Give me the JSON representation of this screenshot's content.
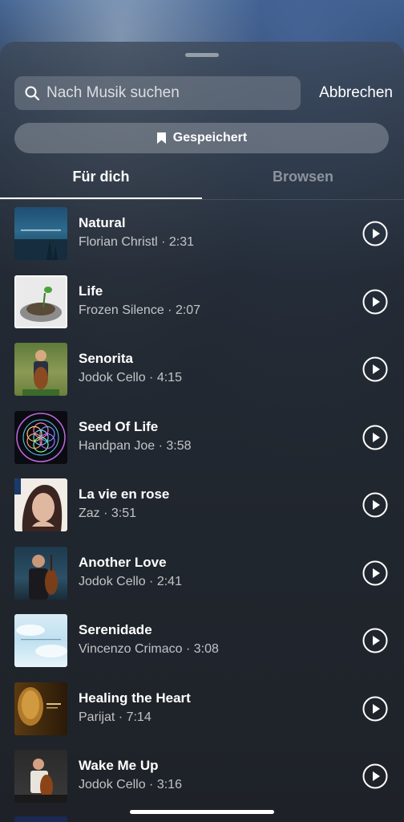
{
  "search": {
    "placeholder": "Nach Musik suchen",
    "cancel_label": "Abbrechen"
  },
  "saved": {
    "label": "Gespeichert"
  },
  "tabs": [
    {
      "label": "Für dich",
      "active": true
    },
    {
      "label": "Browsen",
      "active": false
    }
  ],
  "tracks": [
    {
      "title": "Natural",
      "artist": "Florian Christl",
      "duration": "2:31",
      "sep": " · "
    },
    {
      "title": "Life",
      "artist": "Frozen Silence",
      "duration": "2:07",
      "sep": " · "
    },
    {
      "title": "Senorita",
      "artist": "Jodok Cello",
      "duration": "4:15",
      "sep": " · "
    },
    {
      "title": "Seed Of Life",
      "artist": "Handpan Joe",
      "duration": "3:58",
      "sep": " · "
    },
    {
      "title": "La vie en rose",
      "artist": "Zaz",
      "duration": "3:51",
      "sep": " · "
    },
    {
      "title": "Another Love",
      "artist": "Jodok Cello",
      "duration": "2:41",
      "sep": " · "
    },
    {
      "title": "Serenidade",
      "artist": "Vincenzo Crimaco",
      "duration": "3:08",
      "sep": " · "
    },
    {
      "title": "Healing the Heart",
      "artist": "Parijat",
      "duration": "7:14",
      "sep": " · "
    },
    {
      "title": "Wake Me Up",
      "artist": "Jodok Cello",
      "duration": "3:16",
      "sep": " · "
    }
  ],
  "icons": {
    "search": "search-icon",
    "bookmark": "bookmark-icon",
    "play": "play-icon"
  }
}
